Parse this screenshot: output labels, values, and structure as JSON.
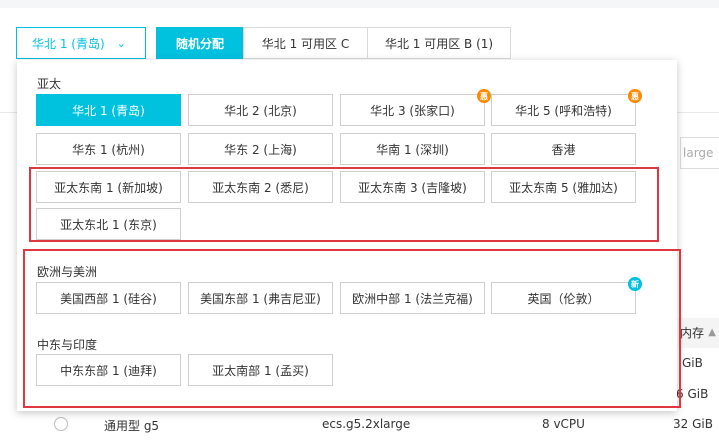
{
  "header": {
    "region_select": {
      "label": "华北 1 (青岛)",
      "chevron": "chevron-down-icon"
    },
    "zone_tabs": [
      "随机分配",
      "华北 1 可用区 C",
      "华北 1 可用区 B (1)"
    ]
  },
  "background": {
    "search_placeholder": "large",
    "column_header": "内存",
    "memory_values": [
      "GiB",
      "6 GiB",
      "32 GiB"
    ],
    "row": {
      "family": "通用型 g5",
      "spec": "ecs.g5.2xlarge",
      "vcpu": "8 vCPU"
    }
  },
  "dropdown": {
    "groups": [
      {
        "label": "亚太",
        "regions": [
          "华北 1 (青岛)",
          "华北 2 (北京)",
          "华北 3 (张家口)",
          "华北 5 (呼和浩特)",
          "华东 1 (杭州)",
          "华东 2 (上海)",
          "华南 1 (深圳)",
          "香港",
          "亚太东南 1 (新加坡)",
          "亚太东南 2 (悉尼)",
          "亚太东南 3 (吉隆坡)",
          "亚太东南 5 (雅加达)",
          "亚太东北 1 (东京)"
        ]
      },
      {
        "label": "欧洲与美洲",
        "regions": [
          "美国西部 1 (硅谷)",
          "美国东部 1 (弗吉尼亚)",
          "欧洲中部 1 (法兰克福)",
          "英国（伦敦）"
        ]
      },
      {
        "label": "中东与印度",
        "regions": [
          "中东东部 1 (迪拜)",
          "亚太南部 1 (孟买)"
        ]
      }
    ],
    "selected": "华北 1 (青岛)",
    "badges": {
      "hot": "惠",
      "new": "新"
    },
    "colors": {
      "accent": "#00c1de",
      "hot": "#ff8a00",
      "highlight": "#e0383e"
    }
  }
}
